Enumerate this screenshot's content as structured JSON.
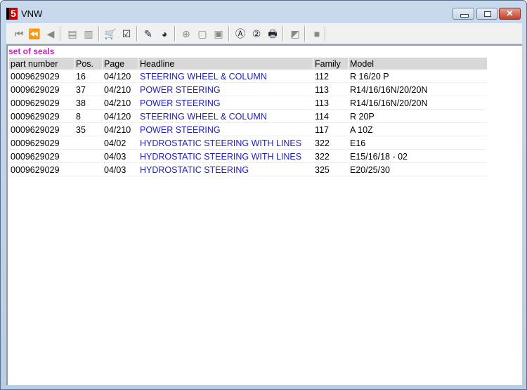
{
  "window": {
    "title": "VNW",
    "app_icon": "5"
  },
  "toolbar": [
    {
      "name": "first-record-icon",
      "glyph": "⏮",
      "enabled": false
    },
    {
      "name": "previous-page-icon",
      "glyph": "⏪",
      "enabled": false
    },
    {
      "name": "previous-record-icon",
      "glyph": "◀",
      "enabled": false
    },
    {
      "name": "back-document-icon",
      "glyph": "▤",
      "enabled": false
    },
    {
      "name": "forward-document-icon",
      "glyph": "▥",
      "enabled": false
    },
    {
      "name": "cart-icon",
      "glyph": "🛒",
      "enabled": true
    },
    {
      "name": "checklist-icon",
      "glyph": "☑",
      "enabled": true
    },
    {
      "name": "seal-tool-icon",
      "glyph": "✎",
      "enabled": true
    },
    {
      "name": "globe-icon",
      "glyph": "◕",
      "enabled": true
    },
    {
      "name": "zoom-in-icon",
      "glyph": "⊕",
      "enabled": false
    },
    {
      "name": "page-icon",
      "glyph": "▢",
      "enabled": false
    },
    {
      "name": "page-alt-icon",
      "glyph": "▣",
      "enabled": false
    },
    {
      "name": "search-a-icon",
      "glyph": "Ⓐ",
      "enabled": true
    },
    {
      "name": "search-2-icon",
      "glyph": "②",
      "enabled": true
    },
    {
      "name": "print-icon",
      "glyph": "🖶",
      "enabled": true
    },
    {
      "name": "note-icon",
      "glyph": "◩",
      "enabled": false
    },
    {
      "name": "stop-icon",
      "glyph": "■",
      "enabled": false
    }
  ],
  "caption": "set of seals",
  "table": {
    "headers": [
      "part number",
      "Pos.",
      "Page",
      "Headline",
      "Family",
      "Model"
    ],
    "rows": [
      [
        "0009629029",
        "16",
        "04/120",
        "STEERING WHEEL & COLUMN",
        "112",
        "R 16/20 P"
      ],
      [
        "0009629029",
        "37",
        "04/210",
        "POWER STEERING",
        "113",
        "R14/16/16N/20/20N"
      ],
      [
        "0009629029",
        "38",
        "04/210",
        "POWER STEERING",
        "113",
        "R14/16/16N/20/20N"
      ],
      [
        "0009629029",
        "8",
        "04/120",
        "STEERING WHEEL & COLUMN",
        "114",
        "R 20P"
      ],
      [
        "0009629029",
        "35",
        "04/210",
        "POWER STEERING",
        "117",
        "A 10Z"
      ],
      [
        "0009629029",
        "",
        "04/02",
        "HYDROSTATIC STEERING WITH LINES",
        "322",
        "E16"
      ],
      [
        "0009629029",
        "",
        "04/03",
        "HYDROSTATIC STEERING WITH LINES",
        "322",
        "E15/16/18 - 02"
      ],
      [
        "0009629029",
        "",
        "04/03",
        "HYDROSTATIC STEERING",
        "325",
        "E20/25/30"
      ]
    ]
  }
}
